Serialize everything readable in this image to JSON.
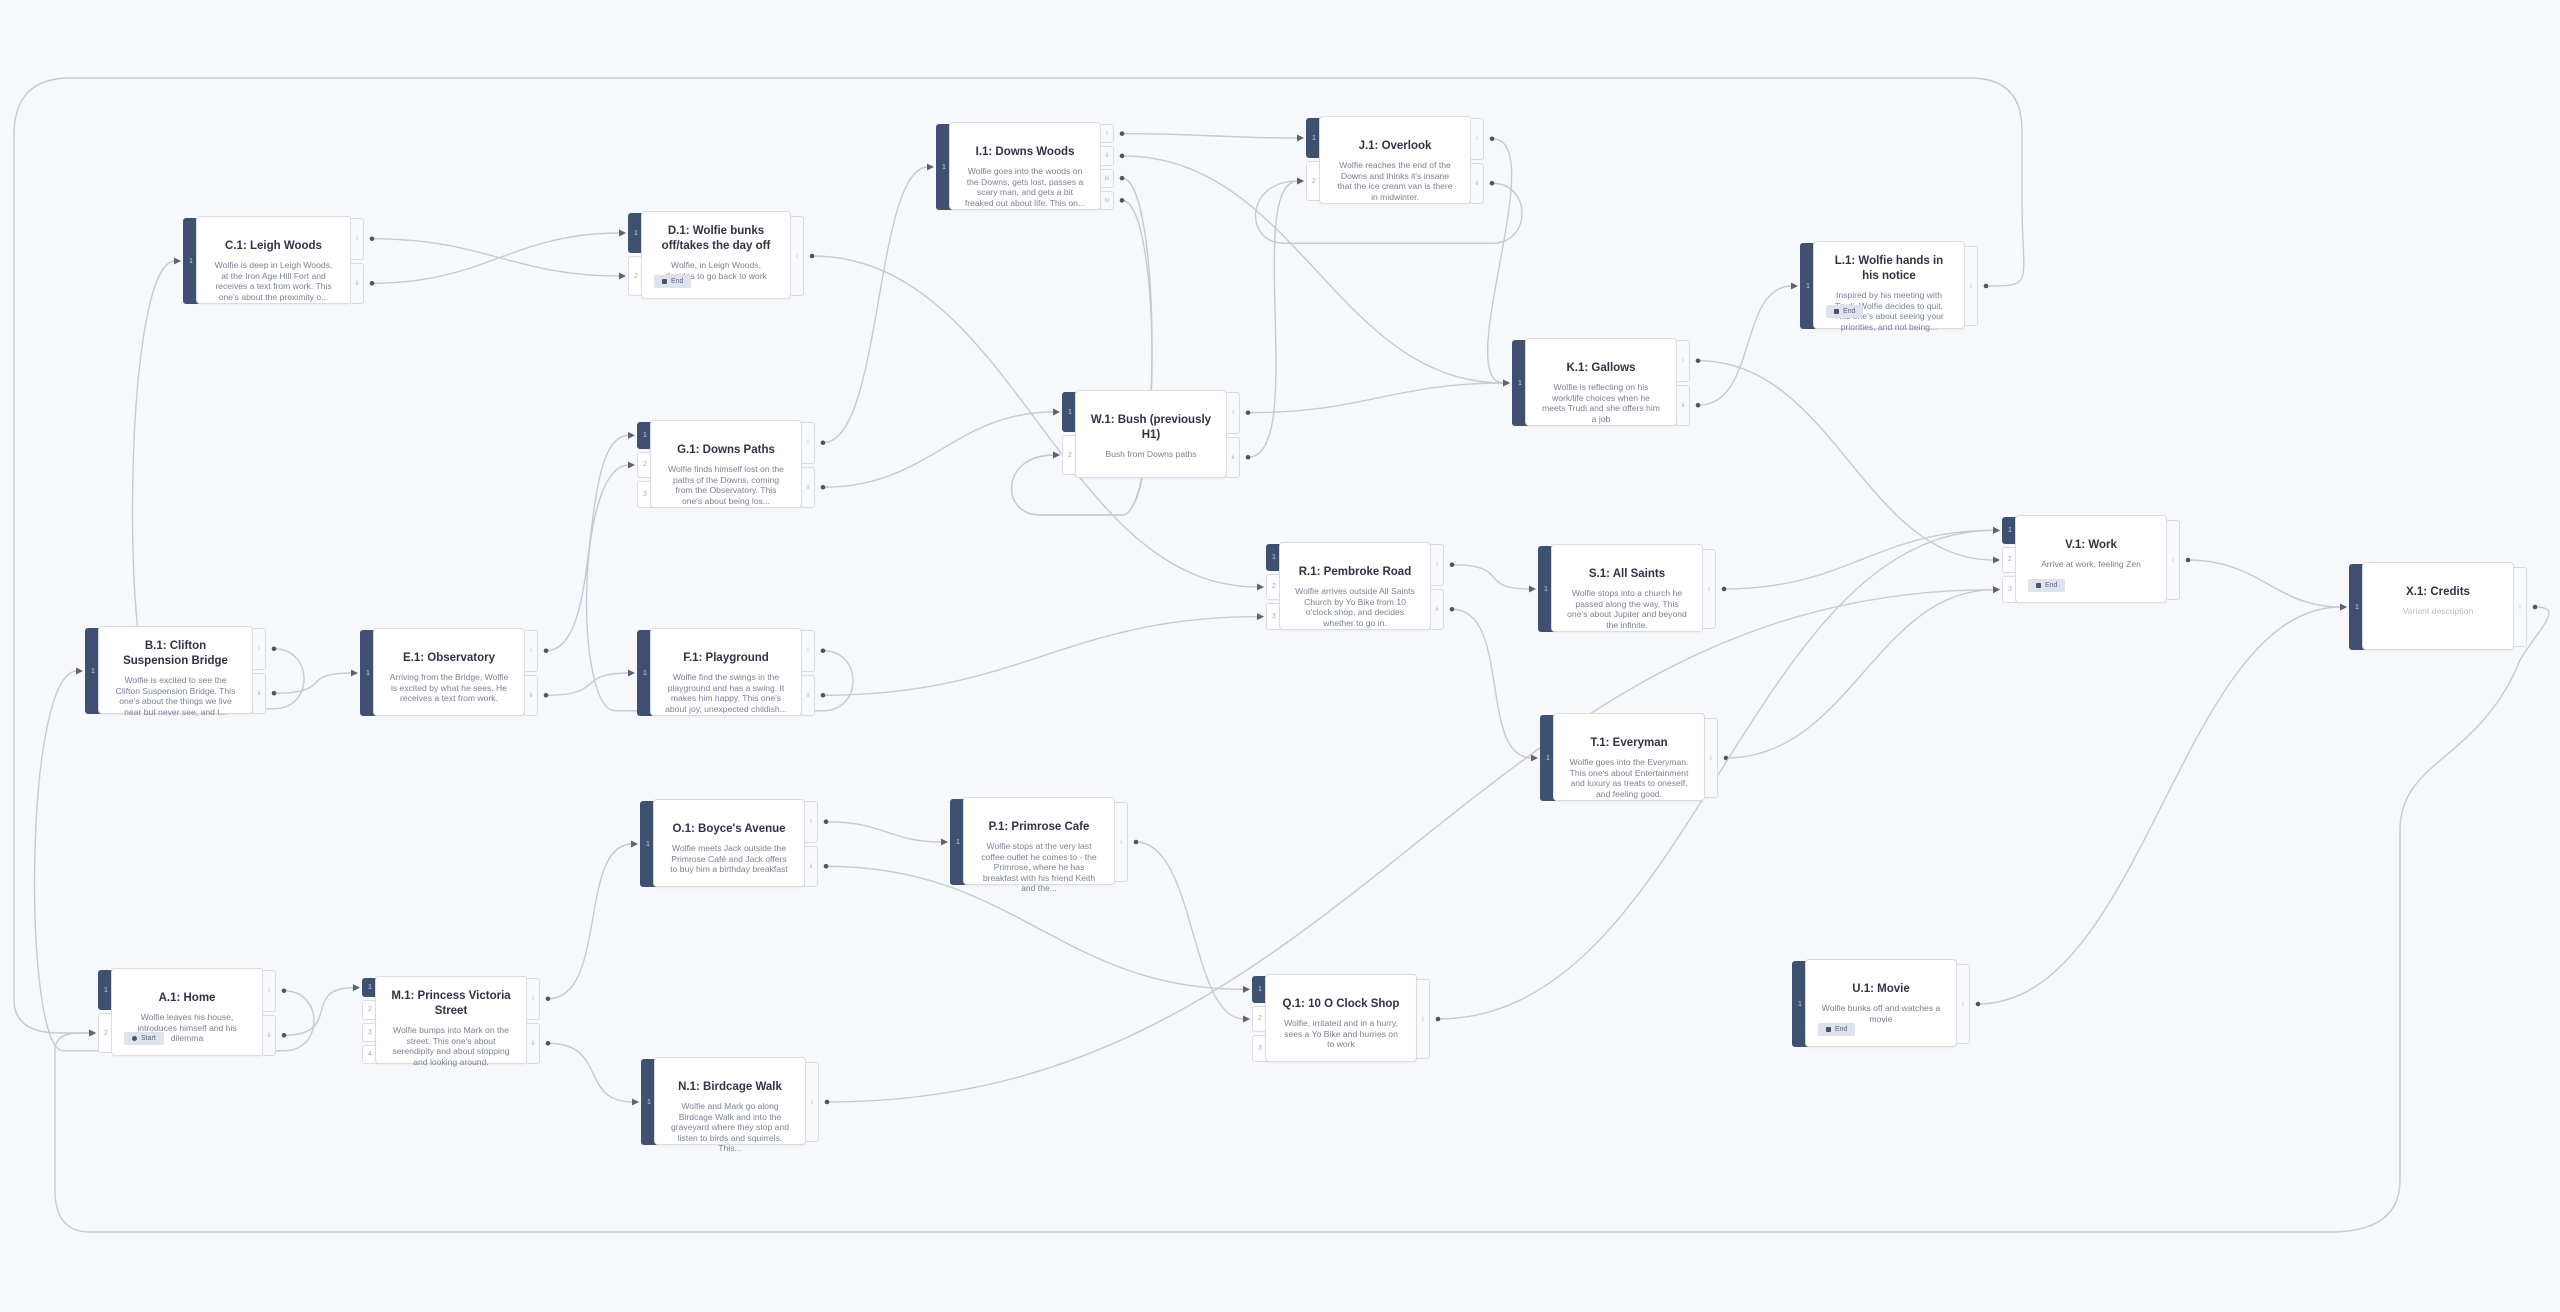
{
  "colors": {
    "background": "#f7f8fb",
    "active_port": "#3f5170",
    "edge": "#c5c9d3"
  },
  "nodes": [
    {
      "id": "C",
      "title": "C.1: Leigh Woods",
      "desc": "Wolfie is deep in Leigh Woods, at the Iron Age Hill Fort and receives a text from work. This one's about the proximity o...",
      "inputs": [
        "1"
      ],
      "active_input": "1",
      "outputs": [
        "i",
        "ii"
      ]
    },
    {
      "id": "D",
      "title": "D.1: Wolfie bunks off/takes the day off",
      "desc": "Wolfie, in Leigh Woods, decides to go back to work",
      "inputs": [
        "1",
        "2"
      ],
      "active_input": "1",
      "outputs": [
        "i"
      ],
      "badge": "End"
    },
    {
      "id": "I",
      "title": "I.1: Downs Woods",
      "desc": "Wolfie goes into the woods on the Downs, gets lost, passes a scary man, and gets a bit freaked out about life. This on...",
      "inputs": [
        "1"
      ],
      "active_input": "1",
      "outputs": [
        "i",
        "ii",
        "iii",
        "iv"
      ]
    },
    {
      "id": "J",
      "title": "J.1: Overlook",
      "desc": "Wolfie reaches the end of the Downs and thinks it's insane that the ice cream van is there in midwinter.",
      "inputs": [
        "1",
        "2"
      ],
      "active_input": "1",
      "outputs": [
        "i",
        "ii"
      ]
    },
    {
      "id": "L",
      "title": "L.1: Wolfie hands in his notice",
      "desc": "Inspired by his meeting with Trudi, Wolfie decides to quit. This one's about seeing your priorities, and not being...",
      "inputs": [
        "1"
      ],
      "active_input": "1",
      "outputs": [
        "i"
      ],
      "badge": "End"
    },
    {
      "id": "K",
      "title": "K.1: Gallows",
      "desc": "Wolfie is reflecting on his work/life choices when he meets Trudi and she offers him a job",
      "inputs": [
        "1"
      ],
      "active_input": "1",
      "outputs": [
        "i",
        "ii"
      ]
    },
    {
      "id": "W",
      "title": "W.1: Bush (previously H1)",
      "desc": "Bush from Downs paths",
      "inputs": [
        "1",
        "2"
      ],
      "active_input": "1",
      "outputs": [
        "i",
        "ii"
      ]
    },
    {
      "id": "G",
      "title": "G.1: Downs Paths",
      "desc": "Wolfie finds himself lost on the paths of the Downs, coming from the Observatory. This one's about being los...",
      "inputs": [
        "1",
        "2",
        "3"
      ],
      "active_input": "1",
      "outputs": [
        "i",
        "ii"
      ]
    },
    {
      "id": "B",
      "title": "B.1: Clifton Suspension Bridge",
      "desc": "Wolfie is excited to see the Clifton Suspension Bridge. This one's about the things we live near but never see, and t...",
      "inputs": [
        "1"
      ],
      "active_input": "1",
      "outputs": [
        "i",
        "ii"
      ]
    },
    {
      "id": "E",
      "title": "E.1: Observatory",
      "desc": "Arriving from the Bridge, Wolfie is excited by what he sees. He receives a text from work.",
      "inputs": [
        "1"
      ],
      "active_input": "1",
      "outputs": [
        "i",
        "ii"
      ]
    },
    {
      "id": "F",
      "title": "F.1: Playground",
      "desc": "Wolfie find the swings in the playground and has a swing. It makes him happy.  This one's about joy, unexpected childish...",
      "inputs": [
        "1"
      ],
      "active_input": "1",
      "outputs": [
        "i",
        "ii"
      ]
    },
    {
      "id": "R",
      "title": "R.1: Pembroke Road",
      "desc": "Wolfie arrives outside All Saints Church by Yo Bike from 10 o'clock shop, and decides whether to go in.",
      "inputs": [
        "1",
        "2",
        "3"
      ],
      "active_input": "1",
      "outputs": [
        "i",
        "ii"
      ]
    },
    {
      "id": "S",
      "title": "S.1: All Saints",
      "desc": "Wolfie stops into a church he passed along the way. This one's about Jupiter and beyond the infinite.",
      "inputs": [
        "1"
      ],
      "active_input": "1",
      "outputs": [
        "i"
      ]
    },
    {
      "id": "V",
      "title": "V.1: Work",
      "desc": "Arrive at work, feeling Zen",
      "inputs": [
        "1",
        "2",
        "3"
      ],
      "active_input": "1",
      "outputs": [
        "i"
      ],
      "badge": "End"
    },
    {
      "id": "X",
      "title": "X.1: Credits",
      "desc": "Variant description",
      "placeholder": true,
      "inputs": [
        "1"
      ],
      "active_input": "1",
      "outputs": [
        "i"
      ]
    },
    {
      "id": "T",
      "title": "T.1: Everyman",
      "desc": "Wolfie goes into the Everyman. This one's about Entertainment and luxury as treats to oneself, and feeling good.",
      "inputs": [
        "1"
      ],
      "active_input": "1",
      "outputs": [
        "i"
      ]
    },
    {
      "id": "O",
      "title": "O.1: Boyce's Avenue",
      "desc": "Wolfie meets Jack outside the Primrose Café and Jack offers to buy him a birthday breakfast",
      "inputs": [
        "1"
      ],
      "active_input": "1",
      "outputs": [
        "i",
        "ii"
      ]
    },
    {
      "id": "P",
      "title": "P.1: Primrose Cafe",
      "desc": "Wolfie stops at the very last coffee outlet he comes to - the Primrose, where he has breakfast with his friend Keith and the...",
      "inputs": [
        "1"
      ],
      "active_input": "1",
      "outputs": [
        "i"
      ]
    },
    {
      "id": "A",
      "title": "A.1: Home",
      "desc": "Wolfie leaves his house, introduces himself and his dilemma",
      "inputs": [
        "1",
        "2"
      ],
      "active_input": "1",
      "outputs": [
        "i",
        "ii"
      ],
      "badge": "Start",
      "badge_icon": "start"
    },
    {
      "id": "M",
      "title": "M.1: Princess Victoria Street",
      "desc": "Wolfie bumps into Mark on the street. This one's about serendipity and about stopping and looking around.",
      "inputs": [
        "1",
        "2",
        "3",
        "4"
      ],
      "active_input": "1",
      "outputs": [
        "i",
        "ii"
      ]
    },
    {
      "id": "Q",
      "title": "Q.1: 10 O Clock Shop",
      "desc": "Wolfie, irritated and in a hurry, sees a Yo Bike and hurries on to work",
      "inputs": [
        "1",
        "2",
        "3"
      ],
      "active_input": "1",
      "outputs": [
        "i"
      ]
    },
    {
      "id": "U",
      "title": "U.1: Movie",
      "desc": "Wolfie bunks off and watches a movie",
      "inputs": [
        "1"
      ],
      "active_input": "1",
      "outputs": [
        "i"
      ],
      "badge": "End"
    },
    {
      "id": "N",
      "title": "N.1: Birdcage Walk",
      "desc": "Wolfie and Mark go along Birdcage Walk and into the graveyard where they stop and listen to birds and squirrels. This...",
      "inputs": [
        "1"
      ],
      "active_input": "1",
      "outputs": [
        "i"
      ]
    }
  ],
  "edges": [
    {
      "from": "A",
      "out": "i",
      "to": "B",
      "in": "1"
    },
    {
      "from": "A",
      "out": "ii",
      "to": "M",
      "in": "1"
    },
    {
      "from": "B",
      "out": "i",
      "to": "C",
      "in": "1"
    },
    {
      "from": "B",
      "out": "ii",
      "to": "E",
      "in": "1"
    },
    {
      "from": "C",
      "out": "i",
      "to": "D",
      "in": "2"
    },
    {
      "from": "C",
      "out": "ii",
      "to": "D",
      "in": "1"
    },
    {
      "from": "D",
      "out": "i",
      "to": "R",
      "in": "2"
    },
    {
      "from": "E",
      "out": "i",
      "to": "G",
      "in": "1"
    },
    {
      "from": "E",
      "out": "ii",
      "to": "F",
      "in": "1"
    },
    {
      "from": "F",
      "out": "i",
      "to": "G",
      "in": "2"
    },
    {
      "from": "F",
      "out": "ii",
      "to": "R",
      "in": "3"
    },
    {
      "from": "G",
      "out": "i",
      "to": "I",
      "in": "1"
    },
    {
      "from": "G",
      "out": "ii",
      "to": "W",
      "in": "1"
    },
    {
      "from": "I",
      "out": "i",
      "to": "J",
      "in": "1"
    },
    {
      "from": "I",
      "out": "ii",
      "to": "K",
      "in": "1"
    },
    {
      "from": "I",
      "out": "iii",
      "to": "W",
      "in": "2"
    },
    {
      "from": "I",
      "out": "iv",
      "to": "W",
      "in": "2"
    },
    {
      "from": "J",
      "out": "i",
      "to": "K",
      "in": "1"
    },
    {
      "from": "J",
      "out": "ii",
      "to": "J",
      "in": "2"
    },
    {
      "from": "W",
      "out": "i",
      "to": "K",
      "in": "1"
    },
    {
      "from": "W",
      "out": "ii",
      "to": "J",
      "in": "2"
    },
    {
      "from": "K",
      "out": "i",
      "to": "V",
      "in": "2"
    },
    {
      "from": "K",
      "out": "ii",
      "to": "L",
      "in": "1"
    },
    {
      "from": "L",
      "out": "i",
      "to": "A",
      "in": "2"
    },
    {
      "from": "R",
      "out": "i",
      "to": "S",
      "in": "1"
    },
    {
      "from": "R",
      "out": "ii",
      "to": "T",
      "in": "1"
    },
    {
      "from": "S",
      "out": "i",
      "to": "V",
      "in": "1"
    },
    {
      "from": "T",
      "out": "i",
      "to": "V",
      "in": "3"
    },
    {
      "from": "V",
      "out": "i",
      "to": "X",
      "in": "1"
    },
    {
      "from": "X",
      "out": "i",
      "to": "A",
      "in": "2"
    },
    {
      "from": "M",
      "out": "i",
      "to": "O",
      "in": "1"
    },
    {
      "from": "M",
      "out": "ii",
      "to": "N",
      "in": "1"
    },
    {
      "from": "O",
      "out": "i",
      "to": "P",
      "in": "1"
    },
    {
      "from": "O",
      "out": "ii",
      "to": "Q",
      "in": "1"
    },
    {
      "from": "P",
      "out": "i",
      "to": "Q",
      "in": "2"
    },
    {
      "from": "Q",
      "out": "i",
      "to": "V",
      "in": "1"
    },
    {
      "from": "N",
      "out": "i",
      "to": "V",
      "in": "3"
    },
    {
      "from": "U",
      "out": "i",
      "to": "X",
      "in": "1"
    }
  ]
}
